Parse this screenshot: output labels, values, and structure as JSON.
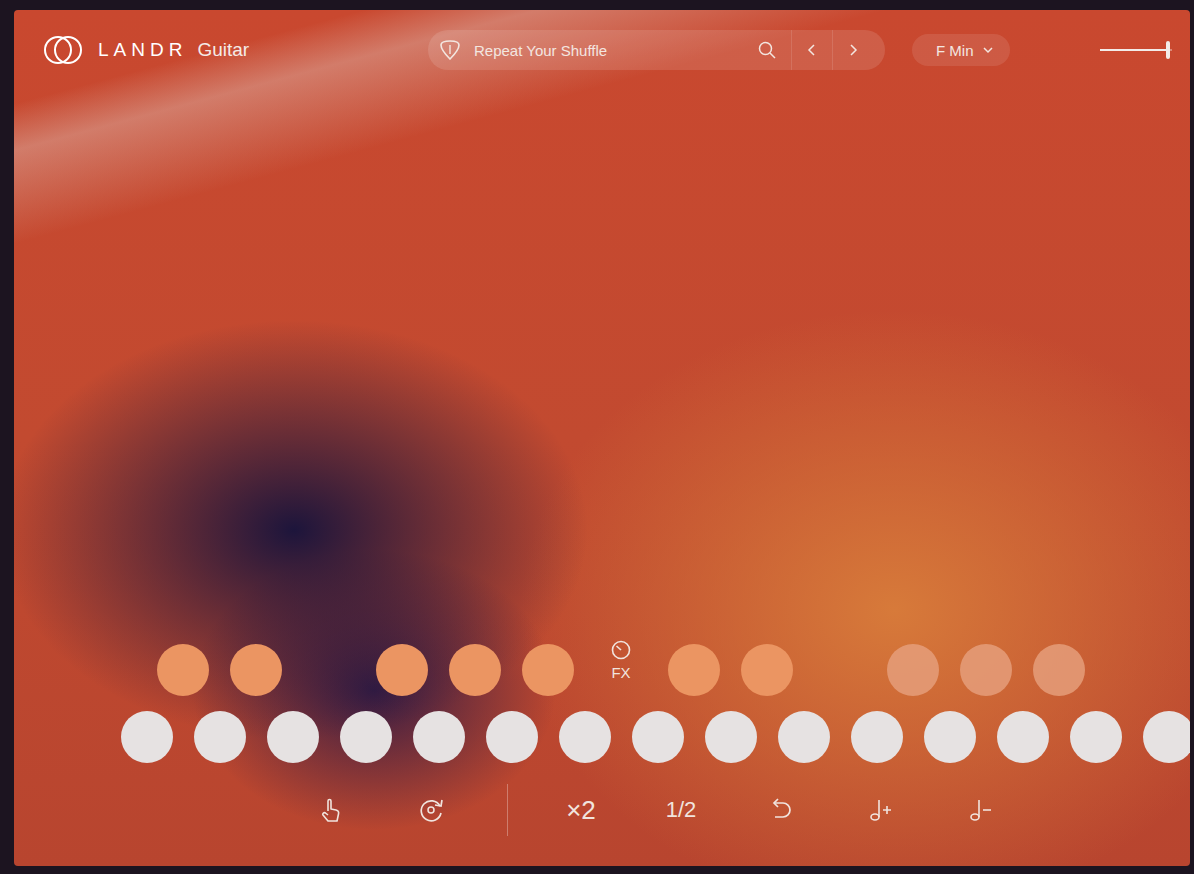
{
  "brand": {
    "name": "LANDR",
    "product": "Guitar"
  },
  "preset": {
    "name": "Repeat Your Shuffle"
  },
  "key": {
    "label": "F Min"
  },
  "volume": {
    "level": 0.94
  },
  "chord_pads": [
    {
      "kind": "pad",
      "dimmed": false,
      "label": ""
    },
    {
      "kind": "pad",
      "dimmed": false,
      "label": ""
    },
    {
      "kind": "empty",
      "dimmed": false,
      "label": ""
    },
    {
      "kind": "pad",
      "dimmed": false,
      "label": ""
    },
    {
      "kind": "pad",
      "dimmed": false,
      "label": ""
    },
    {
      "kind": "pad",
      "dimmed": false,
      "label": ""
    },
    {
      "kind": "fx",
      "dimmed": false,
      "label": "FX"
    },
    {
      "kind": "pad",
      "dimmed": false,
      "label": ""
    },
    {
      "kind": "pad",
      "dimmed": false,
      "label": ""
    },
    {
      "kind": "empty",
      "dimmed": false,
      "label": ""
    },
    {
      "kind": "pad",
      "dimmed": true,
      "label": ""
    },
    {
      "kind": "pad",
      "dimmed": true,
      "label": ""
    },
    {
      "kind": "pad",
      "dimmed": true,
      "label": ""
    }
  ],
  "note_keys": [
    {
      "pressed": false
    },
    {
      "pressed": false
    },
    {
      "pressed": false
    },
    {
      "pressed": false
    },
    {
      "pressed": false
    },
    {
      "pressed": false
    },
    {
      "pressed": false
    },
    {
      "pressed": false
    },
    {
      "pressed": false
    },
    {
      "pressed": false
    },
    {
      "pressed": false
    },
    {
      "pressed": false
    },
    {
      "pressed": false
    },
    {
      "pressed": false
    },
    {
      "pressed": false
    }
  ],
  "toolbar": {
    "double": "×2",
    "half": "1/2"
  }
}
